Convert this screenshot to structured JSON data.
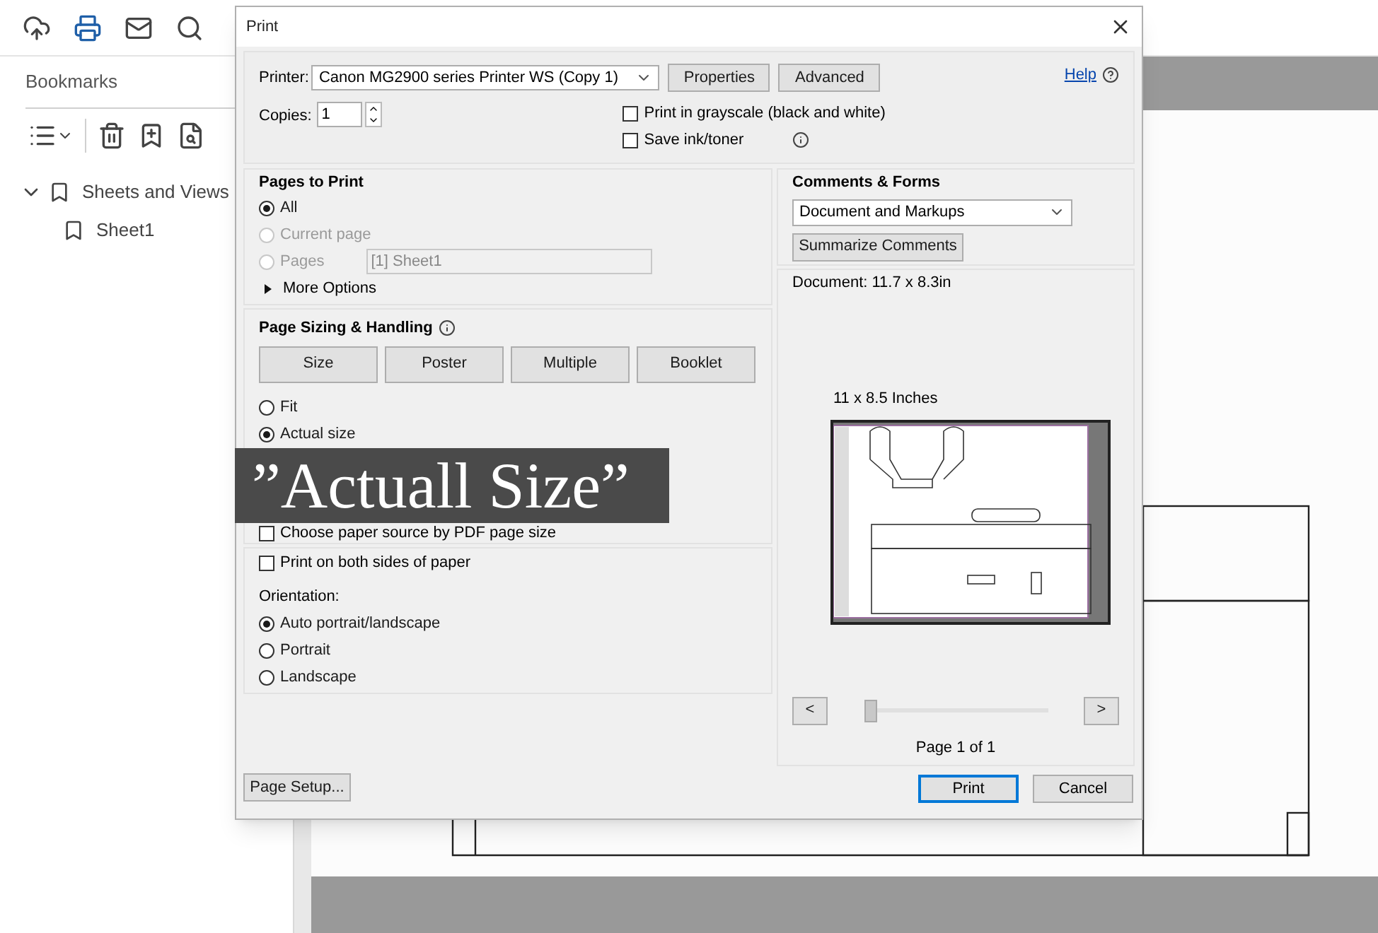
{
  "sidebar": {
    "title": "Bookmarks",
    "tree": [
      {
        "label": "Sheets and Views",
        "expanded": true,
        "children": [
          {
            "label": "Sheet1"
          }
        ]
      }
    ]
  },
  "dialog": {
    "title": "Print",
    "printer": {
      "label": "Printer:",
      "value": "Canon MG2900 series Printer WS (Copy 1)"
    },
    "top_buttons": [
      "Properties",
      "Advanced"
    ],
    "help": "Help",
    "copies": {
      "label": "Copies:",
      "value": "1"
    },
    "options": [
      {
        "label": "Print in grayscale (black and white)",
        "checked": false,
        "info": false
      },
      {
        "label": "Save ink/toner",
        "checked": false,
        "info": true
      }
    ],
    "pages_to_print": {
      "title": "Pages to Print",
      "choices": [
        {
          "label": "All",
          "selected": true,
          "disabled": false
        },
        {
          "label": "Current page",
          "selected": false,
          "disabled": true
        },
        {
          "label": "Pages",
          "selected": false,
          "disabled": true,
          "field": "[1] Sheet1"
        }
      ],
      "more_options": {
        "label": "More Options",
        "expanded": false
      }
    },
    "page_sizing": {
      "title": "Page Sizing & Handling",
      "modes": [
        "Size",
        "Poster",
        "Multiple",
        "Booklet"
      ],
      "choices": [
        {
          "label": "Fit",
          "selected": false
        },
        {
          "label": "Actual size",
          "selected": true
        }
      ],
      "caption": "”Actuall Size”",
      "paper_source": {
        "label": "Choose paper source by PDF page size",
        "checked": false
      }
    },
    "duplex": {
      "label": "Print on both sides of paper",
      "checked": false
    },
    "orientation": {
      "label": "Orientation:",
      "choices": [
        {
          "label": "Auto portrait/landscape",
          "selected": true
        },
        {
          "label": "Portrait",
          "selected": false
        },
        {
          "label": "Landscape",
          "selected": false
        }
      ]
    },
    "page_setup": "Page Setup...",
    "comments_forms": {
      "title": "Comments & Forms",
      "value": "Document and Markups",
      "button": "Summarize Comments"
    },
    "preview": {
      "document_size": "Document: 11.7 x 8.3in",
      "paper_size": "11 x 8.5 Inches",
      "prev": "<",
      "next": ">",
      "level": 0,
      "page_label": "Page 1 of 1"
    },
    "actions": [
      {
        "label": "Print",
        "default": true
      },
      {
        "label": "Cancel",
        "default": false
      }
    ]
  }
}
